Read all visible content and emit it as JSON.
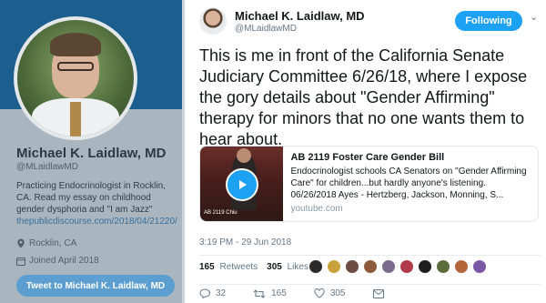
{
  "profile": {
    "name": "Michael K. Laidlaw, MD",
    "handle": "@MLaidlawMD",
    "bio": "Practicing Endocrinologist in Rocklin, CA. Read my essay on childhood gender dysphoria and \"I am Jazz\"",
    "link": "thepublicdiscourse.com/2018/04/21220/",
    "location": "Rocklin, CA",
    "joined": "Joined April 2018",
    "tweet_to_label": "Tweet to Michael K. Laidlaw, MD"
  },
  "tweet": {
    "author_name": "Michael K. Laidlaw, MD",
    "author_handle": "@MLaidlawMD",
    "follow_label": "Following",
    "text": "This is me in front of the California Senate Judiciary Committee 6/26/18, where I expose the gory details about \"Gender Affirming\" therapy for minors that no one wants them to hear about.",
    "card": {
      "title": "AB 2119 Foster Care Gender Bill",
      "description": "Endocrinologist schools CA Senators on \"Gender Affirming Care\" for children...but hardly anyone's listening. 06/26/2018 Ayes - Hertzberg, Jackson, Monning, S...",
      "domain": "youtube.com",
      "thumb_caption": "AB 2119   Chiu"
    },
    "timestamp": "3:19 PM - 29 Jun 2018",
    "retweets_count": "165",
    "retweets_label": "Retweets",
    "likes_count": "305",
    "likes_label": "Likes",
    "reply_count": "32",
    "retweet_action_count": "165",
    "like_action_count": "305"
  },
  "colors": {
    "accent": "#1da1f2",
    "liker_avatars": [
      "#2b2b2b",
      "#c9a23b",
      "#6d4c41",
      "#8e5a3c",
      "#7a6a8e",
      "#b03a48",
      "#1e1e1e",
      "#5c6b3a",
      "#b5653a",
      "#7b57a6"
    ]
  }
}
